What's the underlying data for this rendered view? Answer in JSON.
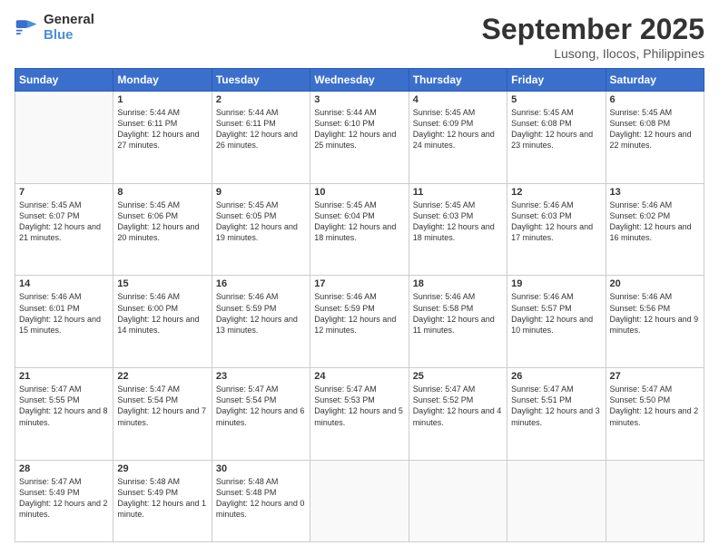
{
  "logo": {
    "text_general": "General",
    "text_blue": "Blue"
  },
  "header": {
    "month": "September 2025",
    "location": "Lusong, Ilocos, Philippines"
  },
  "weekdays": [
    "Sunday",
    "Monday",
    "Tuesday",
    "Wednesday",
    "Thursday",
    "Friday",
    "Saturday"
  ],
  "weeks": [
    [
      {
        "day": "",
        "sunrise": "",
        "sunset": "",
        "daylight": ""
      },
      {
        "day": "1",
        "sunrise": "Sunrise: 5:44 AM",
        "sunset": "Sunset: 6:11 PM",
        "daylight": "Daylight: 12 hours and 27 minutes."
      },
      {
        "day": "2",
        "sunrise": "Sunrise: 5:44 AM",
        "sunset": "Sunset: 6:11 PM",
        "daylight": "Daylight: 12 hours and 26 minutes."
      },
      {
        "day": "3",
        "sunrise": "Sunrise: 5:44 AM",
        "sunset": "Sunset: 6:10 PM",
        "daylight": "Daylight: 12 hours and 25 minutes."
      },
      {
        "day": "4",
        "sunrise": "Sunrise: 5:45 AM",
        "sunset": "Sunset: 6:09 PM",
        "daylight": "Daylight: 12 hours and 24 minutes."
      },
      {
        "day": "5",
        "sunrise": "Sunrise: 5:45 AM",
        "sunset": "Sunset: 6:08 PM",
        "daylight": "Daylight: 12 hours and 23 minutes."
      },
      {
        "day": "6",
        "sunrise": "Sunrise: 5:45 AM",
        "sunset": "Sunset: 6:08 PM",
        "daylight": "Daylight: 12 hours and 22 minutes."
      }
    ],
    [
      {
        "day": "7",
        "sunrise": "Sunrise: 5:45 AM",
        "sunset": "Sunset: 6:07 PM",
        "daylight": "Daylight: 12 hours and 21 minutes."
      },
      {
        "day": "8",
        "sunrise": "Sunrise: 5:45 AM",
        "sunset": "Sunset: 6:06 PM",
        "daylight": "Daylight: 12 hours and 20 minutes."
      },
      {
        "day": "9",
        "sunrise": "Sunrise: 5:45 AM",
        "sunset": "Sunset: 6:05 PM",
        "daylight": "Daylight: 12 hours and 19 minutes."
      },
      {
        "day": "10",
        "sunrise": "Sunrise: 5:45 AM",
        "sunset": "Sunset: 6:04 PM",
        "daylight": "Daylight: 12 hours and 18 minutes."
      },
      {
        "day": "11",
        "sunrise": "Sunrise: 5:45 AM",
        "sunset": "Sunset: 6:03 PM",
        "daylight": "Daylight: 12 hours and 18 minutes."
      },
      {
        "day": "12",
        "sunrise": "Sunrise: 5:46 AM",
        "sunset": "Sunset: 6:03 PM",
        "daylight": "Daylight: 12 hours and 17 minutes."
      },
      {
        "day": "13",
        "sunrise": "Sunrise: 5:46 AM",
        "sunset": "Sunset: 6:02 PM",
        "daylight": "Daylight: 12 hours and 16 minutes."
      }
    ],
    [
      {
        "day": "14",
        "sunrise": "Sunrise: 5:46 AM",
        "sunset": "Sunset: 6:01 PM",
        "daylight": "Daylight: 12 hours and 15 minutes."
      },
      {
        "day": "15",
        "sunrise": "Sunrise: 5:46 AM",
        "sunset": "Sunset: 6:00 PM",
        "daylight": "Daylight: 12 hours and 14 minutes."
      },
      {
        "day": "16",
        "sunrise": "Sunrise: 5:46 AM",
        "sunset": "Sunset: 5:59 PM",
        "daylight": "Daylight: 12 hours and 13 minutes."
      },
      {
        "day": "17",
        "sunrise": "Sunrise: 5:46 AM",
        "sunset": "Sunset: 5:59 PM",
        "daylight": "Daylight: 12 hours and 12 minutes."
      },
      {
        "day": "18",
        "sunrise": "Sunrise: 5:46 AM",
        "sunset": "Sunset: 5:58 PM",
        "daylight": "Daylight: 12 hours and 11 minutes."
      },
      {
        "day": "19",
        "sunrise": "Sunrise: 5:46 AM",
        "sunset": "Sunset: 5:57 PM",
        "daylight": "Daylight: 12 hours and 10 minutes."
      },
      {
        "day": "20",
        "sunrise": "Sunrise: 5:46 AM",
        "sunset": "Sunset: 5:56 PM",
        "daylight": "Daylight: 12 hours and 9 minutes."
      }
    ],
    [
      {
        "day": "21",
        "sunrise": "Sunrise: 5:47 AM",
        "sunset": "Sunset: 5:55 PM",
        "daylight": "Daylight: 12 hours and 8 minutes."
      },
      {
        "day": "22",
        "sunrise": "Sunrise: 5:47 AM",
        "sunset": "Sunset: 5:54 PM",
        "daylight": "Daylight: 12 hours and 7 minutes."
      },
      {
        "day": "23",
        "sunrise": "Sunrise: 5:47 AM",
        "sunset": "Sunset: 5:54 PM",
        "daylight": "Daylight: 12 hours and 6 minutes."
      },
      {
        "day": "24",
        "sunrise": "Sunrise: 5:47 AM",
        "sunset": "Sunset: 5:53 PM",
        "daylight": "Daylight: 12 hours and 5 minutes."
      },
      {
        "day": "25",
        "sunrise": "Sunrise: 5:47 AM",
        "sunset": "Sunset: 5:52 PM",
        "daylight": "Daylight: 12 hours and 4 minutes."
      },
      {
        "day": "26",
        "sunrise": "Sunrise: 5:47 AM",
        "sunset": "Sunset: 5:51 PM",
        "daylight": "Daylight: 12 hours and 3 minutes."
      },
      {
        "day": "27",
        "sunrise": "Sunrise: 5:47 AM",
        "sunset": "Sunset: 5:50 PM",
        "daylight": "Daylight: 12 hours and 2 minutes."
      }
    ],
    [
      {
        "day": "28",
        "sunrise": "Sunrise: 5:47 AM",
        "sunset": "Sunset: 5:49 PM",
        "daylight": "Daylight: 12 hours and 2 minutes."
      },
      {
        "day": "29",
        "sunrise": "Sunrise: 5:48 AM",
        "sunset": "Sunset: 5:49 PM",
        "daylight": "Daylight: 12 hours and 1 minute."
      },
      {
        "day": "30",
        "sunrise": "Sunrise: 5:48 AM",
        "sunset": "Sunset: 5:48 PM",
        "daylight": "Daylight: 12 hours and 0 minutes."
      },
      {
        "day": "",
        "sunrise": "",
        "sunset": "",
        "daylight": ""
      },
      {
        "day": "",
        "sunrise": "",
        "sunset": "",
        "daylight": ""
      },
      {
        "day": "",
        "sunrise": "",
        "sunset": "",
        "daylight": ""
      },
      {
        "day": "",
        "sunrise": "",
        "sunset": "",
        "daylight": ""
      }
    ]
  ]
}
